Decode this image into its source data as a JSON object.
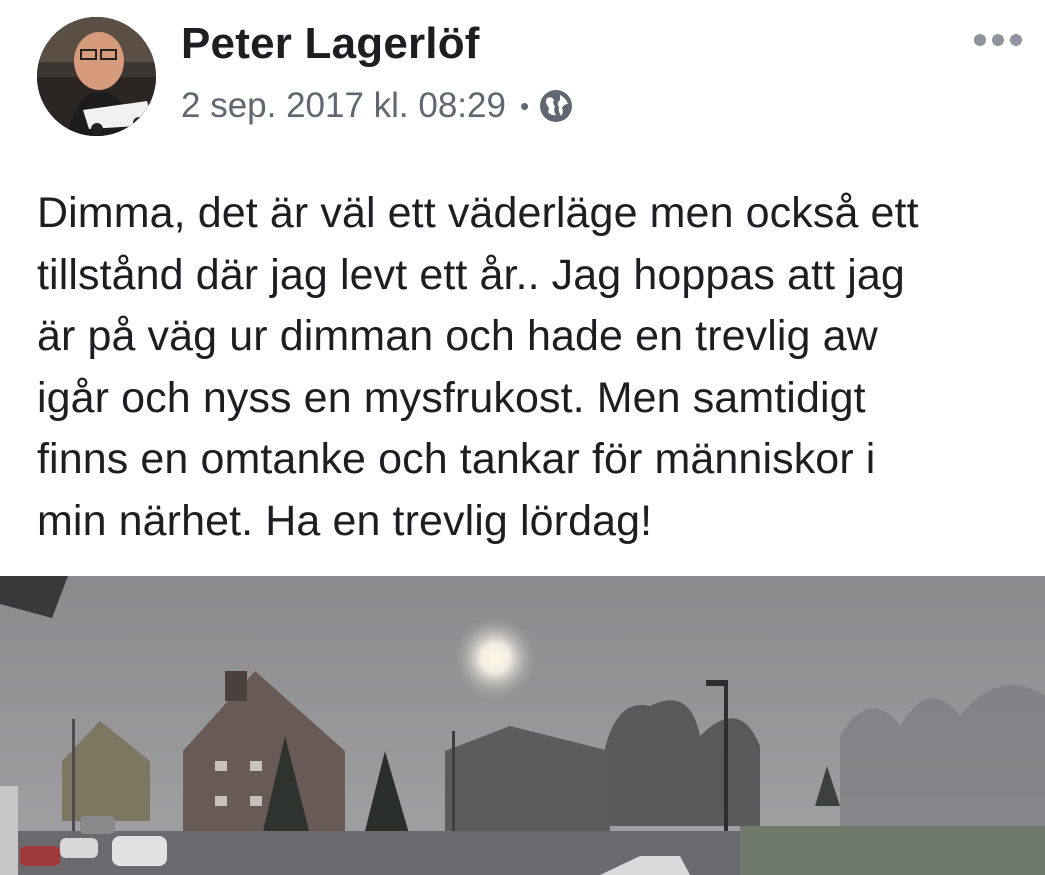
{
  "post": {
    "author": "Peter Lagerlöf",
    "timestamp": "2 sep. 2017 kl. 08:29",
    "separator": "•",
    "audience_icon": "globe-icon",
    "more_icon": "more-options-icon",
    "text": "Dimma, det är väl ett väderläge men också ett\ntillstånd där jag levt ett år..  Jag hoppas att jag\när på väg ur dimman och hade en trevlig aw\nigår och nyss en mysfrukost. Men samtidigt\nfinns en omtanke och tankar för människor i\nmin närhet. Ha en trevlig lördag!"
  },
  "colors": {
    "text": "#1c1e21",
    "meta": "#606770",
    "icon_gray": "#8d949e"
  }
}
